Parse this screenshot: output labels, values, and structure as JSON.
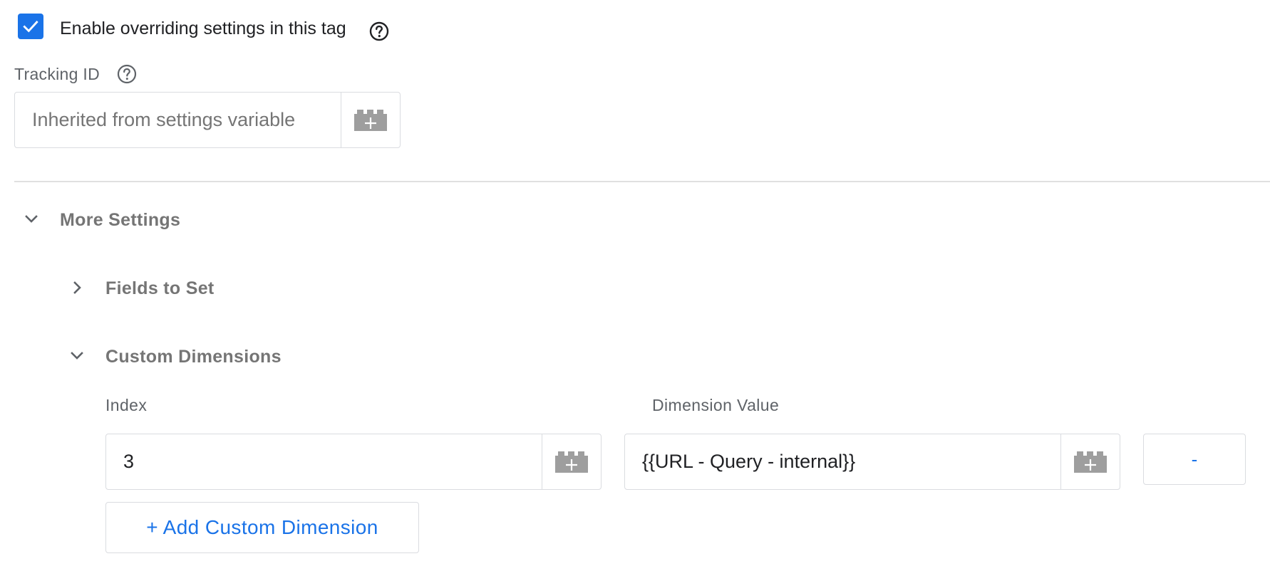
{
  "override": {
    "checked": true,
    "label": "Enable overriding settings in this tag"
  },
  "tracking": {
    "label": "Tracking ID",
    "placeholder": "Inherited from settings variable",
    "value": ""
  },
  "sections": {
    "more_settings": {
      "title": "More Settings",
      "expanded": true
    },
    "fields_to_set": {
      "title": "Fields to Set",
      "expanded": false
    },
    "custom_dimensions": {
      "title": "Custom Dimensions",
      "expanded": true
    }
  },
  "custom_dimensions": {
    "index_header": "Index",
    "value_header": "Dimension Value",
    "rows": [
      {
        "index": "3",
        "value": "{{URL - Query - internal}}",
        "remove_label": "-"
      }
    ],
    "add_label": "+ Add Custom Dimension"
  },
  "icons": {
    "checkbox": "check-icon",
    "help": "help-circle-icon",
    "variable": "variable-brick-icon",
    "expanded": "chevron-down-icon",
    "collapsed": "chevron-right-icon"
  },
  "colors": {
    "accent": "#1a73e8",
    "border": "#dadce0",
    "section_text": "#757575",
    "label_text": "#5f6368",
    "variable_icon": "#9e9e9e"
  }
}
